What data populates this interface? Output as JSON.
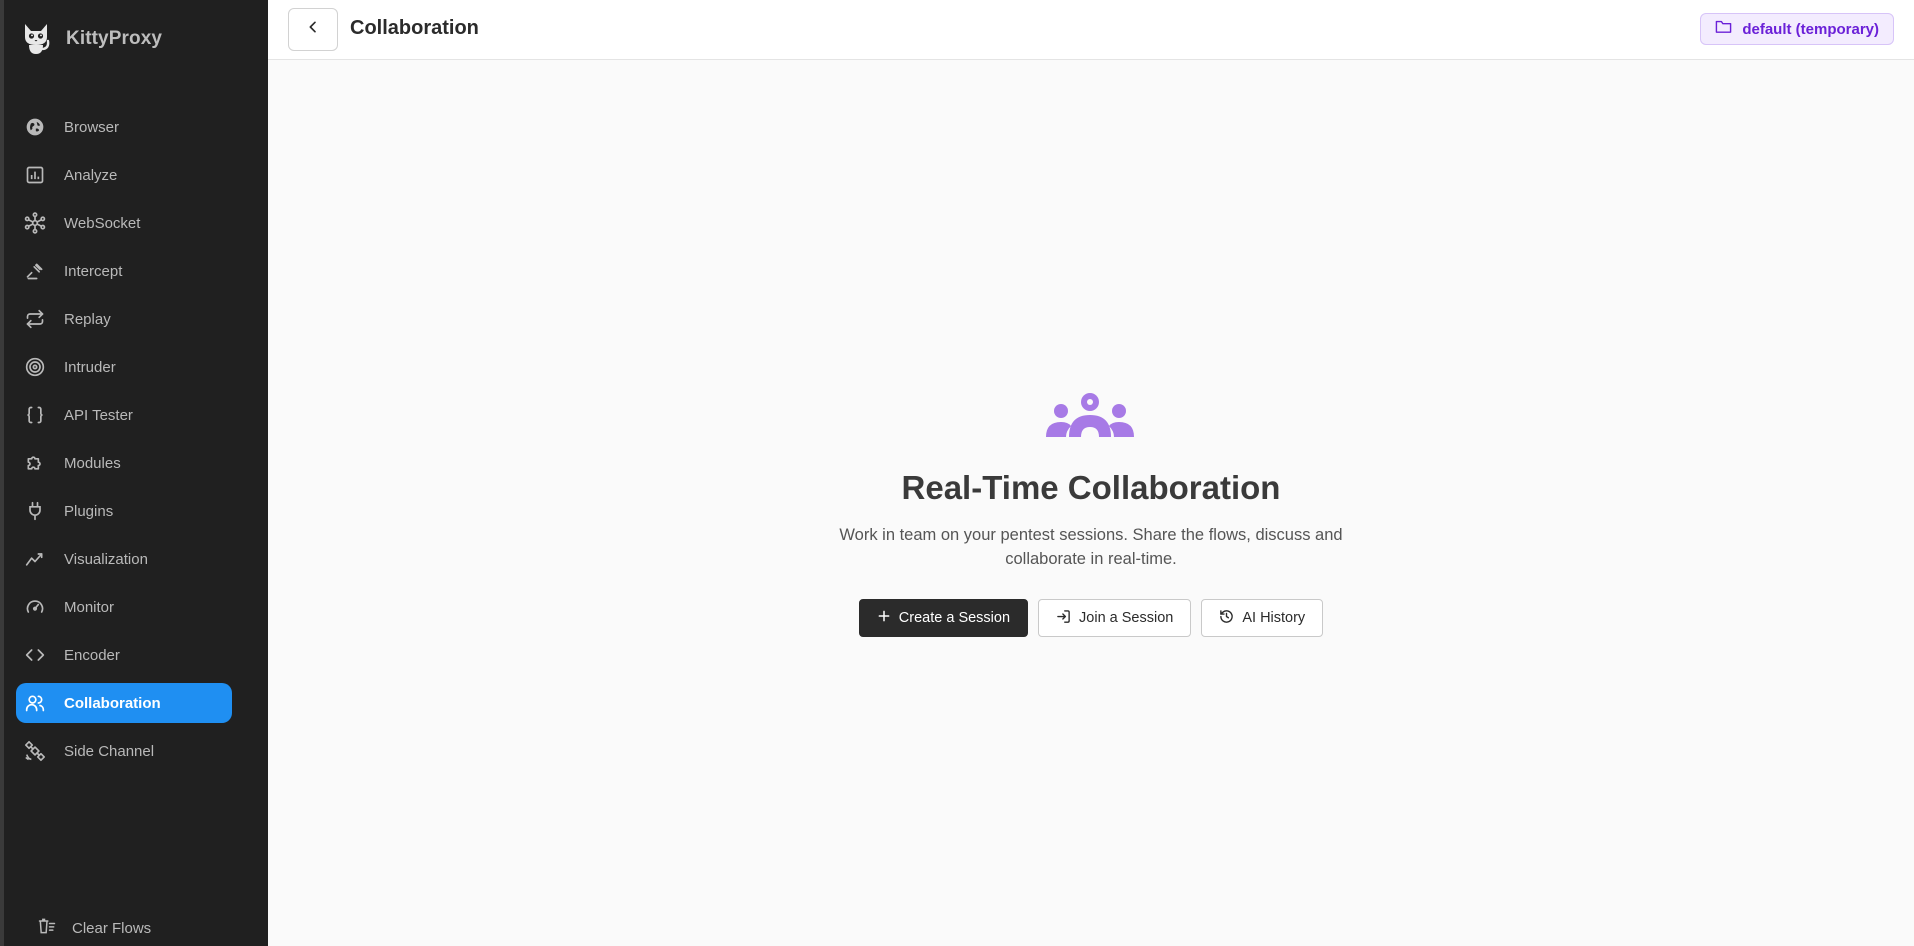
{
  "app": {
    "name": "KittyProxy"
  },
  "sidebar": {
    "items": [
      {
        "label": "Browser",
        "icon": "globe-icon",
        "active": false
      },
      {
        "label": "Analyze",
        "icon": "bar-chart-icon",
        "active": false
      },
      {
        "label": "WebSocket",
        "icon": "network-icon",
        "active": false
      },
      {
        "label": "Intercept",
        "icon": "gavel-icon",
        "active": false
      },
      {
        "label": "Replay",
        "icon": "repeat-icon",
        "active": false
      },
      {
        "label": "Intruder",
        "icon": "target-icon",
        "active": false
      },
      {
        "label": "API Tester",
        "icon": "braces-icon",
        "active": false
      },
      {
        "label": "Modules",
        "icon": "puzzle-icon",
        "active": false
      },
      {
        "label": "Plugins",
        "icon": "plug-icon",
        "active": false
      },
      {
        "label": "Visualization",
        "icon": "trend-icon",
        "active": false
      },
      {
        "label": "Monitor",
        "icon": "gauge-icon",
        "active": false
      },
      {
        "label": "Encoder",
        "icon": "code-icon",
        "active": false
      },
      {
        "label": "Collaboration",
        "icon": "users-icon",
        "active": true
      },
      {
        "label": "Side Channel",
        "icon": "satellite-icon",
        "active": false
      }
    ],
    "clear_flows_label": "Clear Flows"
  },
  "header": {
    "title": "Collaboration",
    "project_label": "default (temporary)"
  },
  "main": {
    "title": "Real-Time Collaboration",
    "description_line1": "Work in team on your pentest sessions. Share the flows, discuss and",
    "description_line2": "collaborate in real-time.",
    "buttons": {
      "create": "Create a Session",
      "join": "Join a Session",
      "history": "AI History"
    }
  },
  "colors": {
    "sidebar_bg": "#202020",
    "active_item": "#1f8ff2",
    "accent_purple": "#a77ae6",
    "badge_text": "#6b21d8"
  }
}
